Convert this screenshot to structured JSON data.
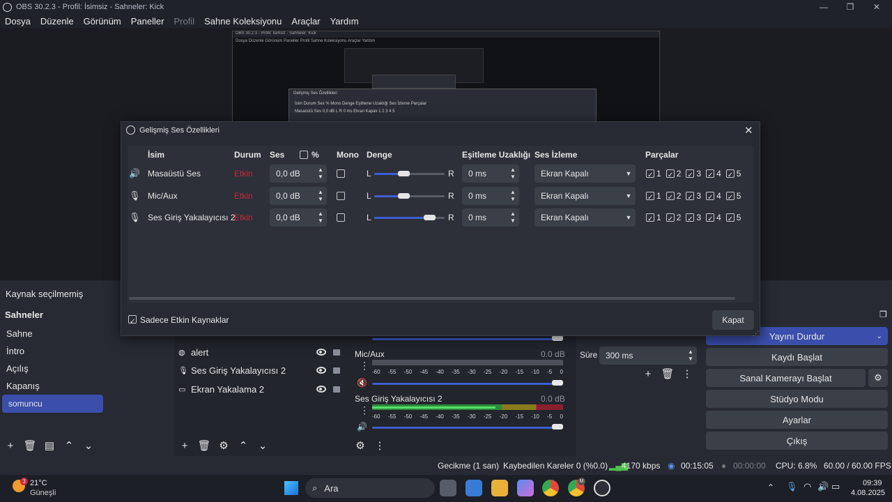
{
  "window": {
    "title": "OBS 30.2.3 - Profil: İsimsiz - Sahneler: Kick"
  },
  "menu": {
    "items": [
      "Dosya",
      "Düzenle",
      "Görünüm",
      "Paneller",
      "Profil",
      "Sahne Koleksiyonu",
      "Araçlar",
      "Yardım"
    ]
  },
  "nested_preview": {
    "title": "OBS 30.2.3 - Profil: İsimsiz - Sahneler: Kick",
    "menu": "Dosya   Düzenle   Görünüm   Paneller   Profil   Sahne Koleksiyonu   Araçlar   Yardım",
    "dialog_title": "Gelişmiş Ses Özellikleri",
    "header": "İsim   Durum   Ses   %   Mono   Denge   Eşitleme Uzaklığı   Ses İzleme   Parçalar",
    "row": "Masaüstü Ses      0,0 dB      L    R   0 ms   Ekran Kapalı   1 2 3 4 5"
  },
  "source_status": "Kaynak seçilmemiş",
  "scenes": {
    "header": "Sahneler",
    "items": [
      "Sahne",
      "İntro",
      "Açılış",
      "Kapanış",
      "somuncu"
    ],
    "selected": "somuncu"
  },
  "sources": {
    "items": [
      {
        "name": "alert",
        "icon": "browser-icon"
      },
      {
        "name": "Ses Giriş Yakalayıcısı 2",
        "icon": "microphone-icon"
      },
      {
        "name": "Ekran Yakalama 2",
        "icon": "monitor-icon"
      }
    ]
  },
  "mixer": {
    "channels": [
      {
        "name": "Mic/Aux",
        "db": "0.0 dB",
        "muted": true
      },
      {
        "name": "Ses Giriş Yakalayıcısı 2",
        "db": "0.0 dB",
        "muted": false
      }
    ],
    "ticks": [
      "-60",
      "-55",
      "-50",
      "-45",
      "-40",
      "-35",
      "-30",
      "-25",
      "-20",
      "-15",
      "-10",
      "-5",
      "0"
    ]
  },
  "transitions": {
    "duration_label": "Süre",
    "duration_value": "300 ms"
  },
  "controls": {
    "stop_stream": "Yayını Durdur",
    "start_recording": "Kaydı Başlat",
    "virtual_camera": "Sanal Kamerayı Başlat",
    "studio_mode": "Stüdyo Modu",
    "settings": "Ayarlar",
    "exit": "Çıkış"
  },
  "status": {
    "delay": "Gecikme (1 san)",
    "dropped": "Kaybedilen Kareler 0 (%0.0)",
    "bitrate": "4170 kbps",
    "stream_time": "00:15:05",
    "record_time": "00:00:00",
    "cpu": "CPU: 6.8%",
    "fps": "60.00 / 60.00 FPS"
  },
  "dialog": {
    "title": "Gelişmiş Ses Özellikleri",
    "headers": {
      "name": "İsim",
      "status": "Durum",
      "volume": "Ses",
      "percent": "%",
      "mono": "Mono",
      "balance": "Denge",
      "sync": "Eşitleme Uzaklığı",
      "monitor": "Ses İzleme",
      "tracks": "Parçalar"
    },
    "balance_left": "L",
    "balance_right": "R",
    "rows": [
      {
        "name": "Masaüstü Ses",
        "status": "Etkin",
        "volume": "0,0 dB",
        "mono": false,
        "balance": 0.42,
        "sync": "0 ms",
        "monitor": "Ekran Kapalı",
        "icon": "speaker-icon"
      },
      {
        "name": "Mic/Aux",
        "status": "Etkin",
        "volume": "0,0 dB",
        "mono": false,
        "balance": 0.42,
        "sync": "0 ms",
        "monitor": "Ekran Kapalı",
        "icon": "microphone-icon"
      },
      {
        "name": "Ses Giriş Yakalayıcısı 2",
        "status": "Etkin",
        "volume": "0,0 dB",
        "mono": false,
        "balance": 0.78,
        "sync": "0 ms",
        "monitor": "Ekran Kapalı",
        "icon": "microphone-icon"
      }
    ],
    "tracks": [
      "1",
      "2",
      "3",
      "4",
      "5"
    ],
    "only_active_label": "Sadece Etkin Kaynaklar",
    "close_label": "Kapat"
  },
  "taskbar": {
    "weather_temp": "21°C",
    "weather_desc": "Güneşli",
    "weather_badge": "3",
    "search_label": "Ara",
    "time": "09:39",
    "date": "4.08.2025",
    "chrome_badge": "M"
  }
}
